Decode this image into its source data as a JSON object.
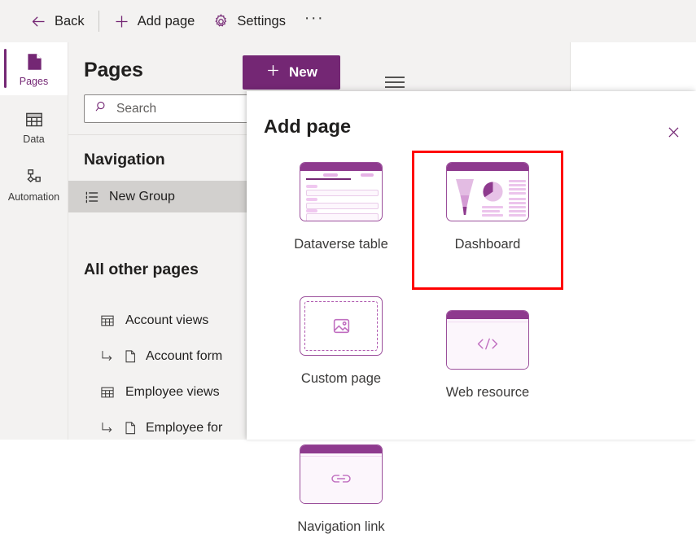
{
  "theme": {
    "brand_purple": "#742774",
    "accent_light": "#e6b3e6",
    "highlight_red": "#ff0000",
    "panel_gray": "#f3f2f1",
    "selection_gray": "#d2d0ce"
  },
  "command_bar": {
    "back_label": "Back",
    "add_page_label": "Add page",
    "settings_label": "Settings",
    "overflow_label": "···"
  },
  "rail": {
    "items": [
      {
        "label": "Pages",
        "icon": "page-icon",
        "selected": true
      },
      {
        "label": "Data",
        "icon": "table-grid-icon",
        "selected": false
      },
      {
        "label": "Automation",
        "icon": "flow-icon",
        "selected": false
      }
    ]
  },
  "pages_panel": {
    "title": "Pages",
    "search": {
      "placeholder": "Search",
      "value": "",
      "icon": "search-icon"
    },
    "navigation": {
      "heading": "Navigation",
      "items": [
        {
          "label": "New Group",
          "icon": "group-list-icon",
          "selected": true,
          "nested": false
        }
      ]
    },
    "all_other_pages": {
      "heading": "All other pages",
      "items": [
        {
          "label": "Account views",
          "icon": "table-grid-icon",
          "nested": false
        },
        {
          "label": "Account form",
          "icon": "document-icon",
          "nested": true
        },
        {
          "label": "Employee views",
          "icon": "table-grid-icon",
          "nested": false
        },
        {
          "label": "Employee for",
          "icon": "document-icon",
          "nested": true
        }
      ]
    }
  },
  "canvas": {
    "new_button_label": "New",
    "menu_icon": "hamburger-icon"
  },
  "dialog": {
    "title": "Add page",
    "close_label": "✕",
    "cards": [
      {
        "label": "Dataverse table",
        "thumb": "dataverse-table-thumb",
        "highlighted": false
      },
      {
        "label": "Dashboard",
        "thumb": "dashboard-thumb",
        "highlighted": true
      },
      {
        "label": "Custom page",
        "thumb": "custom-page-thumb",
        "highlighted": false
      },
      {
        "label": "Web resource",
        "thumb": "web-resource-thumb",
        "highlighted": false
      },
      {
        "label": "Navigation link",
        "thumb": "navigation-link-thumb",
        "highlighted": false
      }
    ]
  }
}
